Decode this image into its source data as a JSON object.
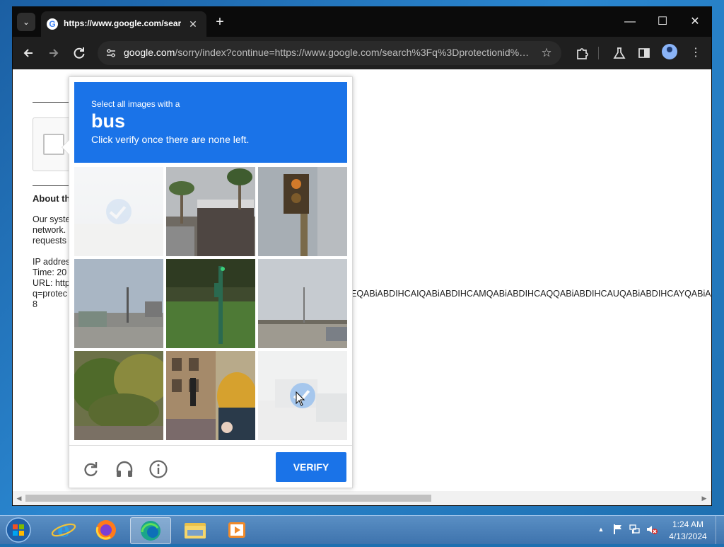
{
  "browser": {
    "tab_title": "https://www.google.com/search?q=protectionid",
    "url_host": "google.com",
    "url_rest": "/sorry/index?continue=https://www.google.com/search%3Fq%3Dprotectionid%…",
    "favicon_letter": "G",
    "icons": {
      "tab_list": "chevron-down-icon",
      "close": "close-icon",
      "new_tab": "plus-icon",
      "back": "arrow-left-icon",
      "forward": "arrow-right-icon",
      "reload": "reload-icon",
      "site_info": "tune-icon",
      "bookmark": "star-icon",
      "extensions": "puzzle-icon",
      "labs": "flask-icon",
      "side_panel": "side-panel-icon",
      "profile": "profile-icon",
      "menu": "kebab-menu-icon"
    }
  },
  "page": {
    "about_heading": "About th",
    "para_lines": [
      "Our syste",
      "network.",
      "requests"
    ],
    "info_lines": [
      "IP addres",
      "Time: 20",
      "URL: http",
      "q=protec",
      "8"
    ],
    "long_string": "EQABiABDIHCAIQABiABDIHCAMQABiABDIHCAQQABiABDIHCAUQABiABDIHCAYQABiABDIHC"
  },
  "captcha": {
    "prompt_line1": "Select all images with a",
    "target": "bus",
    "prompt_line2": "Click verify once there are none left.",
    "verify_label": "VERIFY",
    "tiles": [
      {
        "selected": true
      },
      {
        "selected": false
      },
      {
        "selected": false
      },
      {
        "selected": false
      },
      {
        "selected": false
      },
      {
        "selected": false
      },
      {
        "selected": false
      },
      {
        "selected": false
      },
      {
        "selected": true
      }
    ],
    "colors": {
      "header": "#1a73e8",
      "check": "#4a90e2"
    }
  },
  "taskbar": {
    "time": "1:24 AM",
    "date": "4/13/2024",
    "apps": [
      "internet-explorer-icon",
      "firefox-icon",
      "edge-icon",
      "file-explorer-icon",
      "media-player-icon"
    ]
  }
}
